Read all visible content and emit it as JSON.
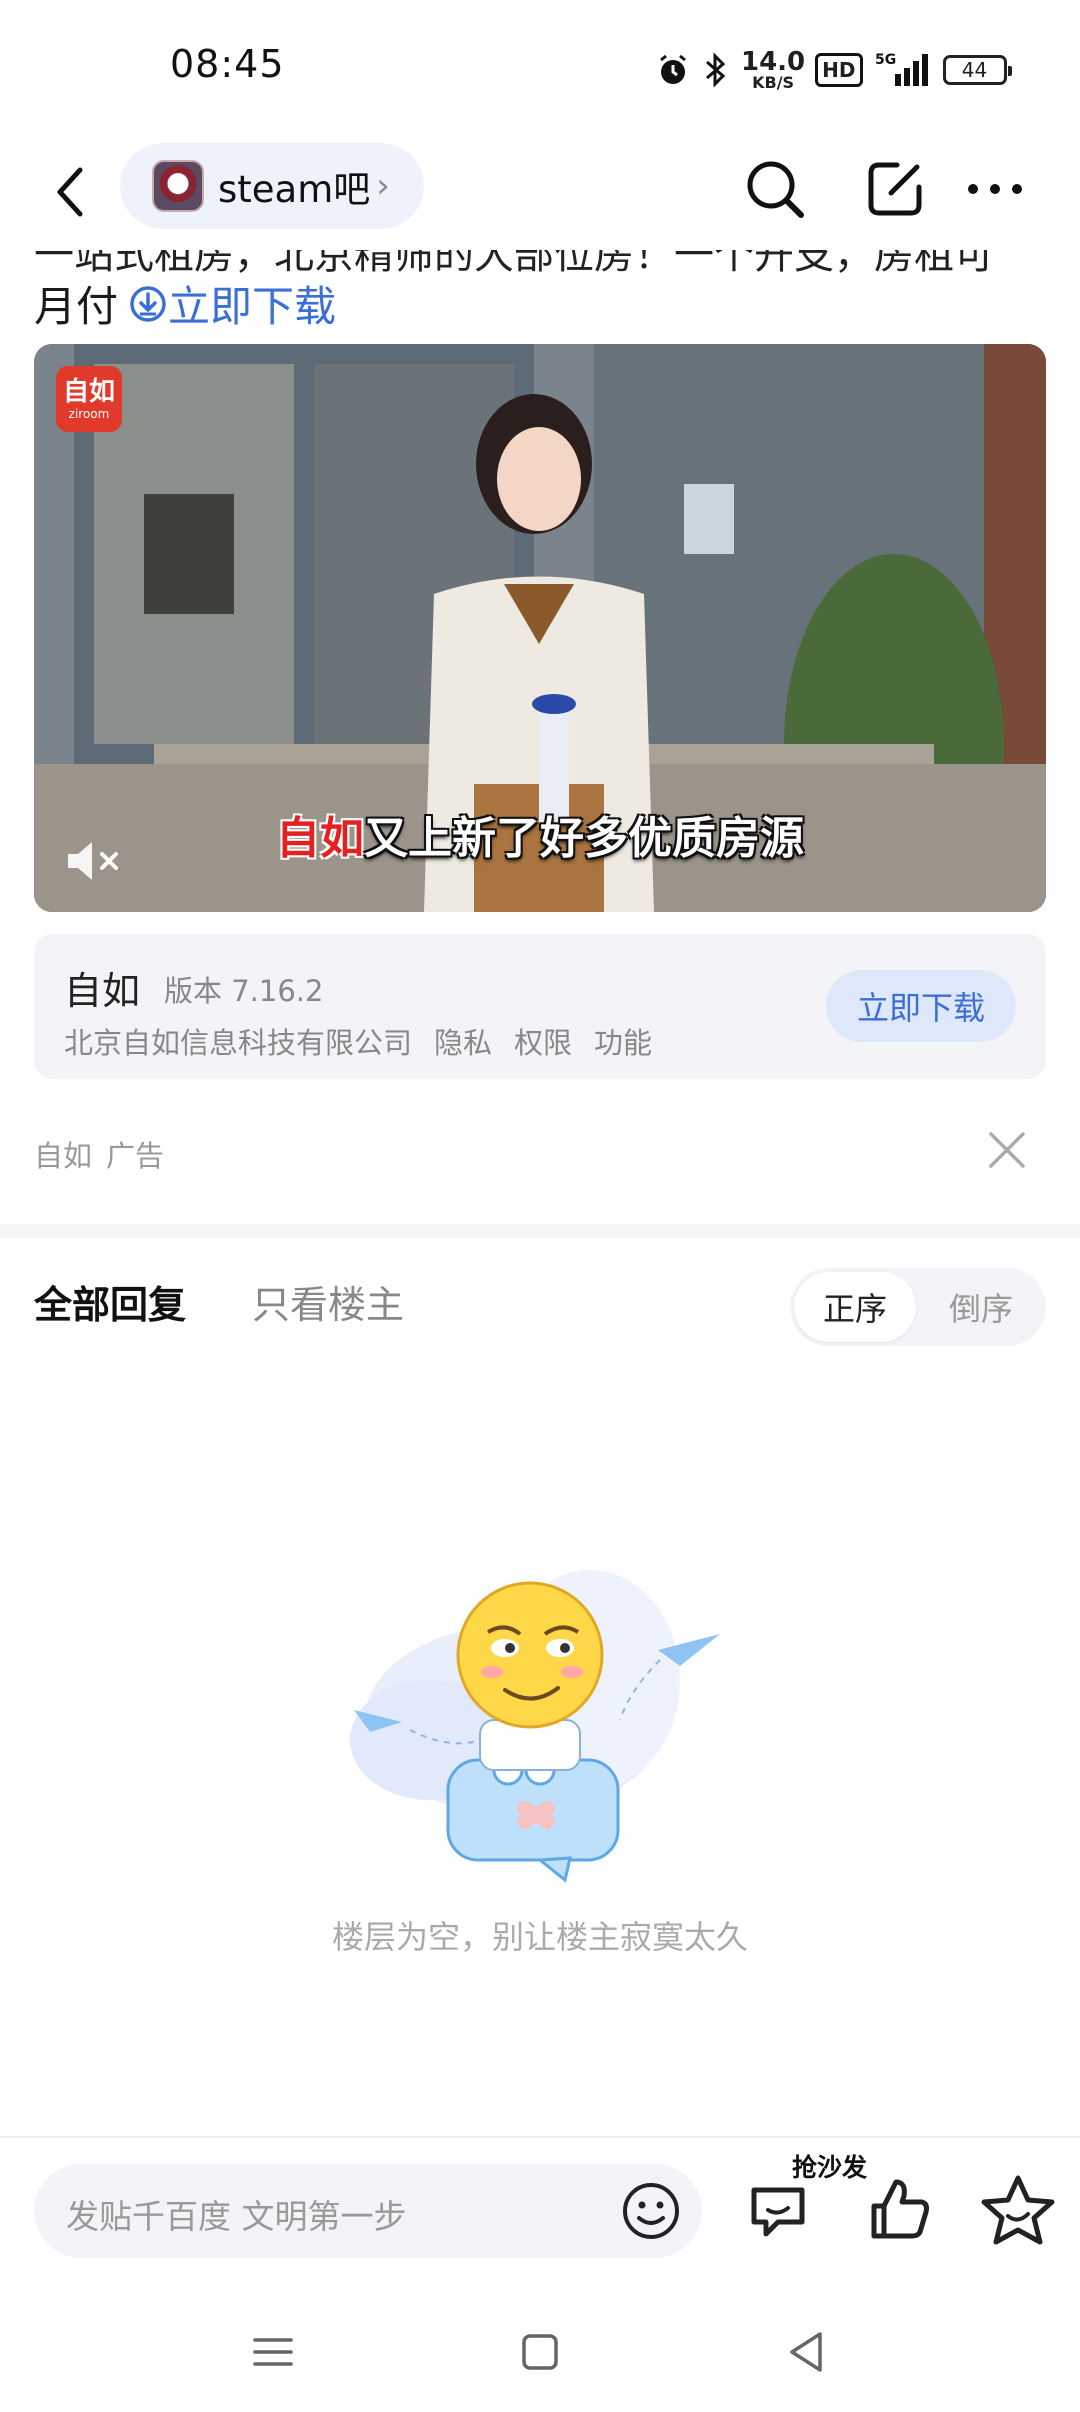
{
  "status_bar": {
    "time": "08:45",
    "net_speed": "14.0",
    "net_unit": "KB/S",
    "hd": "HD",
    "signal": "5G",
    "battery": "44"
  },
  "top_nav": {
    "forum_name": "steam吧",
    "chevron": "›"
  },
  "post": {
    "cut_text": "一站式租房，北京精筛的大部位房！一个开支，房租可",
    "line_text": "月付",
    "download_link": "立即下载"
  },
  "video_ad": {
    "logo_main": "自如",
    "logo_sub": "ziroom",
    "subtitle_highlight": "自如",
    "subtitle_rest": "又上新了好多优质房源"
  },
  "app_card": {
    "name": "自如",
    "version": "版本 7.16.2",
    "company": "北京自如信息科技有限公司",
    "privacy": "隐私",
    "permissions": "权限",
    "features": "功能",
    "download_button": "立即下载"
  },
  "ad_info": {
    "advertiser": "自如",
    "ad_label": "广告"
  },
  "reply_tabs": {
    "all": "全部回复",
    "owner_only": "只看楼主",
    "sort_asc": "正序",
    "sort_desc": "倒序"
  },
  "empty_state": {
    "message": "楼层为空，别让楼主寂寞太久"
  },
  "bottom_bar": {
    "reply_placeholder": "发贴千百度 文明第一步",
    "sofa_label": "抢沙发"
  },
  "colors": {
    "accent": "#3a6fd8",
    "brand_red": "#e23a2a"
  }
}
